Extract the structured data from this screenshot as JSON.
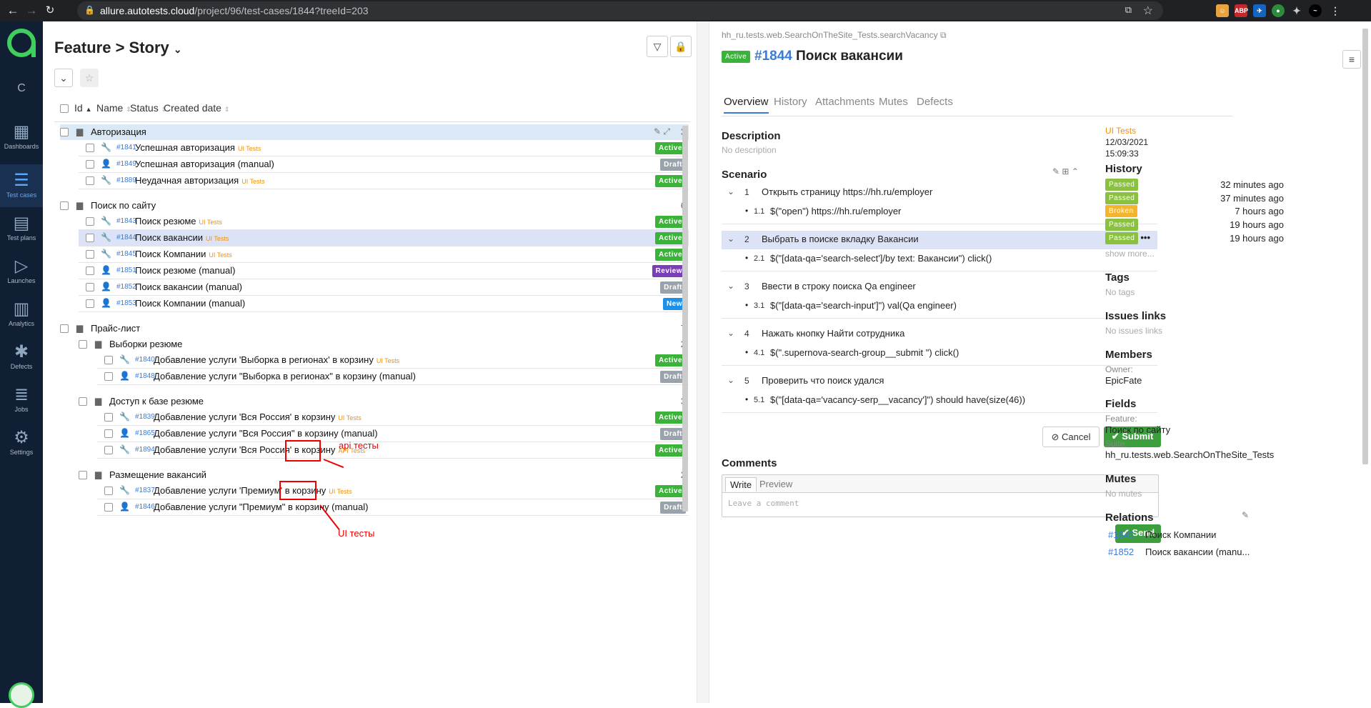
{
  "browser": {
    "url_host": "allure.autotests.cloud",
    "url_path": "/project/96/test-cases/1844?treeId=203"
  },
  "sidebar": {
    "items": [
      {
        "label": "Dashboards",
        "icon": "dashboard-icon"
      },
      {
        "label": "Test cases",
        "icon": "test-cases-icon",
        "active": true
      },
      {
        "label": "Test plans",
        "icon": "test-plans-icon"
      },
      {
        "label": "Launches",
        "icon": "launches-icon"
      },
      {
        "label": "Analytics",
        "icon": "analytics-icon"
      },
      {
        "label": "Defects",
        "icon": "bug-icon"
      },
      {
        "label": "Jobs",
        "icon": "jobs-icon"
      },
      {
        "label": "Settings",
        "icon": "gear-icon"
      }
    ],
    "collapse": "C"
  },
  "tree": {
    "title": "Feature > Story",
    "columns": [
      "Id",
      "Name",
      "Status",
      "Created date"
    ],
    "groups": [
      {
        "name": "Авторизация",
        "count": "3",
        "rows": [
          {
            "id": "#1841",
            "name": "Успешная авторизация",
            "tag": "UI Tests",
            "status": "Active",
            "type": "auto"
          },
          {
            "id": "#1849",
            "name": "Успешная авторизация (manual)",
            "tag": "",
            "status": "Draft",
            "type": "manual"
          },
          {
            "id": "#1889",
            "name": "Неудачная авторизация",
            "tag": "UI Tests",
            "status": "Active",
            "type": "auto"
          }
        ]
      },
      {
        "name": "Поиск по сайту",
        "count": "6",
        "rows": [
          {
            "id": "#1843",
            "name": "Поиск резюме",
            "tag": "UI Tests",
            "status": "Active",
            "type": "auto"
          },
          {
            "id": "#1844",
            "name": "Поиск вакансии",
            "tag": "UI Tests",
            "status": "Active",
            "type": "auto",
            "selected": true
          },
          {
            "id": "#1845",
            "name": "Поиск Компании",
            "tag": "UI Tests",
            "status": "Active",
            "type": "auto"
          },
          {
            "id": "#1851",
            "name": "Поиск резюме (manual)",
            "tag": "",
            "status": "Review",
            "type": "manual"
          },
          {
            "id": "#1852",
            "name": "Поиск вакансии (manual)",
            "tag": "",
            "status": "Draft",
            "type": "manual"
          },
          {
            "id": "#1853",
            "name": "Поиск Компании (manual)",
            "tag": "",
            "status": "New",
            "type": "manual"
          }
        ]
      },
      {
        "name": "Прайс-лист",
        "count": "7",
        "subgroups": [
          {
            "name": "Выборки резюме",
            "count": "2",
            "rows": [
              {
                "id": "#1840",
                "name": "Добавление услуги 'Выборка в регионах' в корзину",
                "tag": "UI Tests",
                "status": "Active",
                "type": "auto"
              },
              {
                "id": "#1848",
                "name": "Добавление услуги \"Выборка в регионах\" в корзину (manual)",
                "tag": "",
                "status": "Draft",
                "type": "manual"
              }
            ]
          },
          {
            "name": "Доступ к базе резюме",
            "count": "3",
            "rows": [
              {
                "id": "#1839",
                "name": "Добавление услуги 'Вся Россия' в корзину",
                "tag": "UI Tests",
                "status": "Active",
                "type": "auto"
              },
              {
                "id": "#1865",
                "name": "Добавление услуги \"Вся Россия\" в корзину (manual)",
                "tag": "",
                "status": "Draft",
                "type": "manual"
              },
              {
                "id": "#1894",
                "name": "Добавление услуги 'Вся Россия' в корзину",
                "tag": "API Tests",
                "status": "Active",
                "type": "auto"
              }
            ]
          },
          {
            "name": "Размещение вакансий",
            "count": "2",
            "rows": [
              {
                "id": "#1837",
                "name": "Добавление услуги 'Премиум' в корзину",
                "tag": "UI Tests",
                "status": "Active",
                "type": "auto"
              },
              {
                "id": "#1846",
                "name": "Добавление услуги \"Премиум\" в корзину (manual)",
                "tag": "",
                "status": "Draft",
                "type": "manual"
              }
            ]
          }
        ]
      }
    ],
    "annotations": {
      "api": "api тесты",
      "ui": "UI тесты"
    }
  },
  "detail": {
    "path": "hh_ru.tests.web.SearchOnTheSite_Tests.searchVacancy",
    "status": "Active",
    "id": "#1844",
    "title": "Поиск вакансии",
    "tabs": [
      "Overview",
      "History",
      "Attachments",
      "Mutes",
      "Defects"
    ],
    "description_label": "Description",
    "description": "No description",
    "scenario_label": "Scenario",
    "steps": [
      {
        "n": "1",
        "text": "Открыть страницу https://hh.ru/employer",
        "sub": {
          "n": "1.1",
          "text": "$(\"open\") https://hh.ru/employer"
        }
      },
      {
        "n": "2",
        "text": "Выбрать в поиске вкладку Вакансии",
        "sub": {
          "n": "2.1",
          "text": "$(\"[data-qa='search-select']/by text: Вакансии\") click()"
        }
      },
      {
        "n": "3",
        "text": "Ввести в строку поиска Qa engineer",
        "sub": {
          "n": "3.1",
          "text": "$(\"[data-qa='search-input']\") val(Qa engineer)"
        }
      },
      {
        "n": "4",
        "text": "Нажать кнопку Найти сотрудника",
        "sub": {
          "n": "4.1",
          "text": "$(\".supernova-search-group__submit \") click()"
        }
      },
      {
        "n": "5",
        "text": "Проверить что поиск удался",
        "sub": {
          "n": "5.1",
          "text": "$(\"[data-qa='vacancy-serp__vacancy']\") should have(size(46))"
        }
      }
    ],
    "cancel": "Cancel",
    "submit": "Submit",
    "comments_label": "Comments",
    "write": "Write",
    "preview": "Preview",
    "comment_placeholder": "Leave a comment",
    "send": "Send",
    "meta": {
      "layer": "UI Tests",
      "date": "12/03/2021",
      "time": "15:09:33",
      "history_label": "History",
      "history": [
        {
          "status": "Passed",
          "time": "32 minutes ago"
        },
        {
          "status": "Passed",
          "time": "37 minutes ago"
        },
        {
          "status": "Broken",
          "time": "7 hours ago"
        },
        {
          "status": "Passed",
          "time": "19 hours ago"
        },
        {
          "status": "Passed",
          "time": "19 hours ago"
        }
      ],
      "show_more": "show more...",
      "tags_label": "Tags",
      "tags": "No tags",
      "issues_label": "Issues links",
      "issues": "No issues links",
      "members_label": "Members",
      "owner_label": "Owner:",
      "owner": "EpicFate",
      "fields_label": "Fields",
      "feature_label": "Feature:",
      "feature": "Поиск по сайту",
      "suite_label": "Suite:",
      "suite": "hh_ru.tests.web.SearchOnTheSite_Tests",
      "mutes_label": "Mutes",
      "mutes": "No mutes",
      "relations_label": "Relations",
      "relations": [
        {
          "id": "#1845",
          "name": "Поиск Компании"
        },
        {
          "id": "#1852",
          "name": "Поиск вакансии (manu..."
        }
      ]
    }
  }
}
